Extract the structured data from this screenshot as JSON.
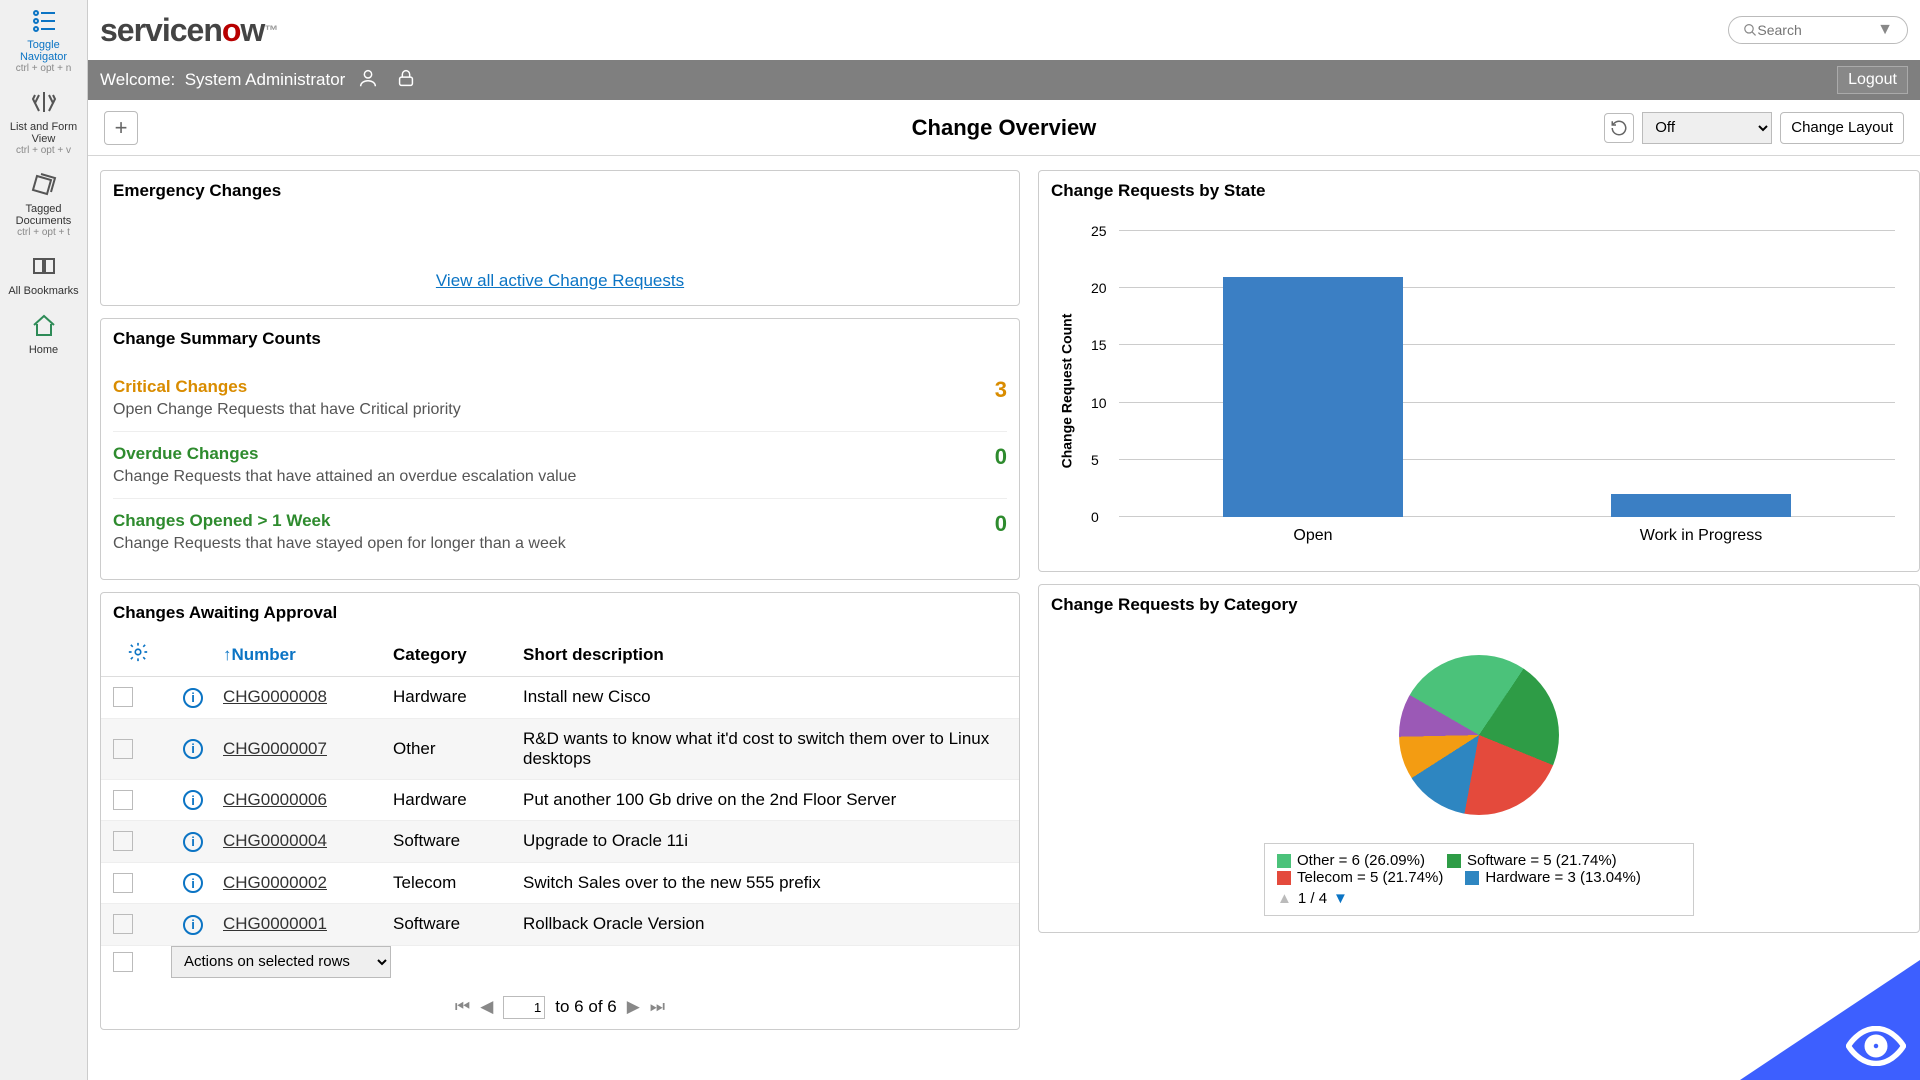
{
  "rail": [
    {
      "name": "toggle-navigator",
      "label": "Toggle Navigator",
      "shortcut": "ctrl + opt + n",
      "active": true
    },
    {
      "name": "list-form-view",
      "label": "List and Form View",
      "shortcut": "ctrl + opt + v",
      "active": false
    },
    {
      "name": "tagged-documents",
      "label": "Tagged Documents",
      "shortcut": "ctrl + opt + t",
      "active": false
    },
    {
      "name": "all-bookmarks",
      "label": "All Bookmarks",
      "shortcut": "",
      "active": false
    },
    {
      "name": "home",
      "label": "Home",
      "shortcut": "",
      "active": false,
      "homeColor": "#2e8b57"
    }
  ],
  "logo_text": "servicenow",
  "search_placeholder": "Search",
  "welcome_prefix": "Welcome:",
  "welcome_user": "System Administrator",
  "logout_label": "Logout",
  "page_title": "Change Overview",
  "refresh_select": "Off",
  "layout_button": "Change Layout",
  "panels": {
    "emergency": {
      "title": "Emergency Changes",
      "link": "View all active Change Requests"
    },
    "summary": {
      "title": "Change Summary Counts",
      "rows": [
        {
          "name": "Critical Changes",
          "desc": "Open Change Requests that have Critical priority",
          "count": "3",
          "color": "clr-orange"
        },
        {
          "name": "Overdue Changes",
          "desc": "Change Requests that have attained an overdue escalation value",
          "count": "0",
          "color": "clr-green"
        },
        {
          "name": "Changes Opened > 1 Week",
          "desc": "Change Requests that have stayed open for longer than a week",
          "count": "0",
          "color": "clr-green"
        }
      ]
    },
    "approval": {
      "title": "Changes Awaiting Approval",
      "columns": {
        "number": "Number",
        "category": "Category",
        "short_desc": "Short description"
      },
      "rows": [
        {
          "number": "CHG0000008",
          "category": "Hardware",
          "desc": "Install new Cisco"
        },
        {
          "number": "CHG0000007",
          "category": "Other",
          "desc": "R&D wants to know what it'd cost to switch them over to Linux desktops"
        },
        {
          "number": "CHG0000006",
          "category": "Hardware",
          "desc": "Put another 100 Gb drive on the 2nd Floor Server"
        },
        {
          "number": "CHG0000004",
          "category": "Software",
          "desc": "Upgrade to Oracle 11i"
        },
        {
          "number": "CHG0000002",
          "category": "Telecom",
          "desc": "Switch Sales over to the new 555 prefix"
        },
        {
          "number": "CHG0000001",
          "category": "Software",
          "desc": "Rollback Oracle Version"
        }
      ],
      "actions_label": "Actions on selected rows",
      "pager": {
        "page": "1",
        "range": "to 6 of 6"
      }
    },
    "bar": {
      "title": "Change Requests by State",
      "ylabel": "Change Request Count"
    },
    "pie": {
      "title": "Change Requests by Category",
      "legend_page": "1 / 4"
    }
  },
  "chart_data": [
    {
      "type": "bar",
      "title": "Change Requests by State",
      "ylabel": "Change Request Count",
      "ylim": [
        0,
        25
      ],
      "categories": [
        "Open",
        "Work in Progress"
      ],
      "values": [
        21,
        2
      ]
    },
    {
      "type": "pie",
      "title": "Change Requests by Category",
      "series": [
        {
          "name": "Other",
          "value": 6,
          "percent": 26.09,
          "color": "#4bc27a"
        },
        {
          "name": "Software",
          "value": 5,
          "percent": 21.74,
          "color": "#2e9c46"
        },
        {
          "name": "Telecom",
          "value": 5,
          "percent": 21.74,
          "color": "#e44a3c"
        },
        {
          "name": "Hardware",
          "value": 3,
          "percent": 13.04,
          "color": "#2e86c1"
        }
      ],
      "legend_rows": [
        [
          {
            "label": "Other = 6 (26.09%)",
            "color": "#4bc27a"
          },
          {
            "label": "Software = 5 (21.74%)",
            "color": "#2e9c46"
          }
        ],
        [
          {
            "label": "Telecom = 5 (21.74%)",
            "color": "#e44a3c"
          },
          {
            "label": "Hardware = 3 (13.04%)",
            "color": "#2e86c1"
          }
        ]
      ],
      "remainder_percent": 17.39,
      "remainder_split": [
        8.7,
        8.69
      ],
      "remainder_colors": [
        "#f39c12",
        "#9b59b6"
      ]
    }
  ]
}
